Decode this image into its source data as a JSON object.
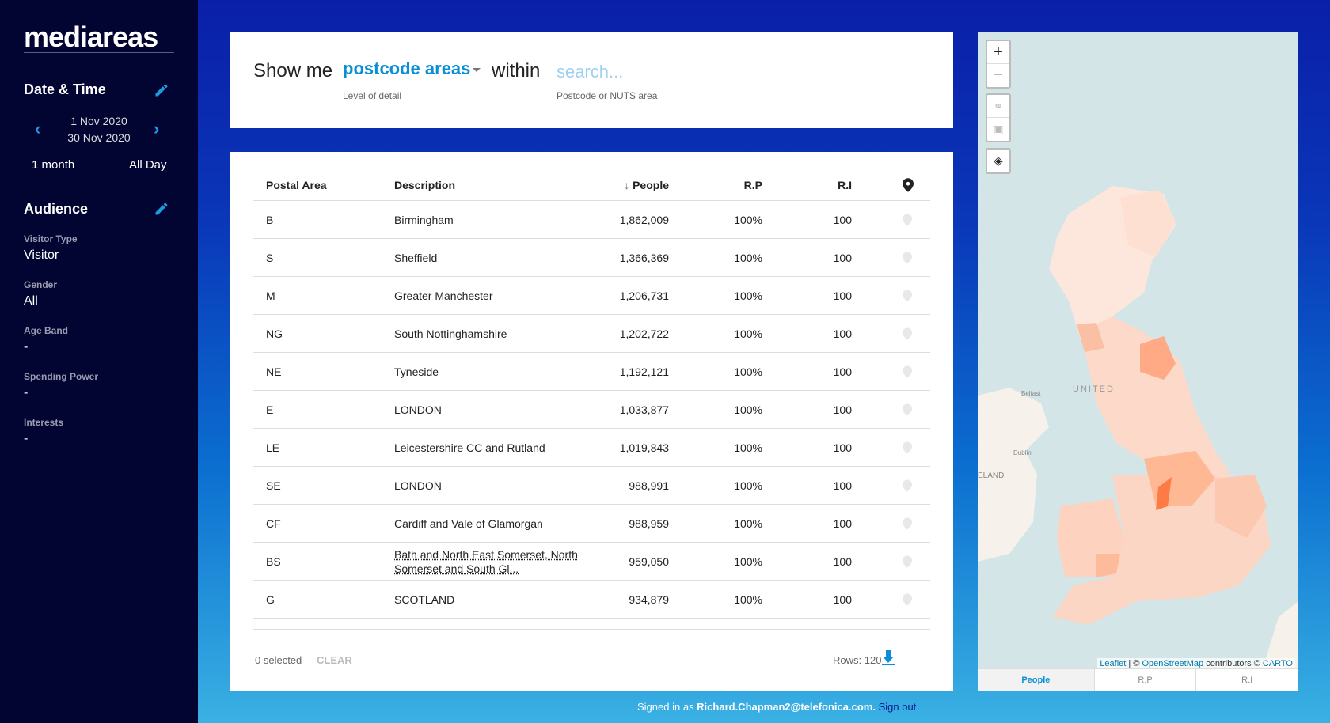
{
  "app": {
    "logo": "mediareas"
  },
  "sidebar": {
    "date_time": {
      "title": "Date & Time",
      "start": "1 Nov 2020",
      "end": "30 Nov 2020",
      "period": "1 month",
      "time": "All Day"
    },
    "audience": {
      "title": "Audience",
      "fields": [
        {
          "label": "Visitor Type",
          "value": "Visitor"
        },
        {
          "label": "Gender",
          "value": "All"
        },
        {
          "label": "Age Band",
          "value": "-"
        },
        {
          "label": "Spending Power",
          "value": "-"
        },
        {
          "label": "Interests",
          "value": "-"
        }
      ]
    }
  },
  "query": {
    "show_me": "Show me",
    "level": "postcode areas",
    "level_hint": "Level of detail",
    "within": "within",
    "search_placeholder": "search...",
    "search_hint": "Postcode or NUTS area"
  },
  "table": {
    "headers": {
      "postal_area": "Postal Area",
      "description": "Description",
      "people": "People",
      "rp": "R.P",
      "ri": "R.I"
    },
    "rows": [
      {
        "area": "B",
        "desc": "Birmingham",
        "people": "1,862,009",
        "rp": "100%",
        "ri": "100"
      },
      {
        "area": "S",
        "desc": "Sheffield",
        "people": "1,366,369",
        "rp": "100%",
        "ri": "100"
      },
      {
        "area": "M",
        "desc": "Greater Manchester",
        "people": "1,206,731",
        "rp": "100%",
        "ri": "100"
      },
      {
        "area": "NG",
        "desc": "South Nottinghamshire",
        "people": "1,202,722",
        "rp": "100%",
        "ri": "100"
      },
      {
        "area": "NE",
        "desc": "Tyneside",
        "people": "1,192,121",
        "rp": "100%",
        "ri": "100"
      },
      {
        "area": "E",
        "desc": "LONDON",
        "people": "1,033,877",
        "rp": "100%",
        "ri": "100"
      },
      {
        "area": "LE",
        "desc": "Leicestershire CC and Rutland",
        "people": "1,019,843",
        "rp": "100%",
        "ri": "100"
      },
      {
        "area": "SE",
        "desc": "LONDON",
        "people": "988,991",
        "rp": "100%",
        "ri": "100"
      },
      {
        "area": "CF",
        "desc": "Cardiff and Vale of Glamorgan",
        "people": "988,959",
        "rp": "100%",
        "ri": "100"
      },
      {
        "area": "BS",
        "desc": "Bath and North East Somerset, North Somerset and South Gl...",
        "people": "959,050",
        "rp": "100%",
        "ri": "100"
      },
      {
        "area": "G",
        "desc": "SCOTLAND",
        "people": "934,879",
        "rp": "100%",
        "ri": "100"
      }
    ],
    "selected": "0 selected",
    "clear": "CLEAR",
    "rows_count": "Rows: 120"
  },
  "map": {
    "labels": {
      "country": "UNITED",
      "belfast": "Belfast",
      "dublin": "Dublin",
      "ireland": "ELAND"
    },
    "attribution": {
      "leaflet": "Leaflet",
      "sep": " | © ",
      "osm": "OpenStreetMap",
      "contrib": " contributors © ",
      "carto": "CARTO"
    },
    "tabs": [
      "People",
      "R.P",
      "R.I"
    ],
    "active_tab": "People"
  },
  "footer": {
    "signed_in_as": "Signed in as ",
    "user": "Richard.Chapman2@telefonica.com.",
    "sign_out": "Sign out"
  },
  "colors": {
    "accent": "#0a8fd6",
    "sidebar": "#020431",
    "choropleth_high": "#ff7b45",
    "choropleth_low": "#fde8de"
  }
}
